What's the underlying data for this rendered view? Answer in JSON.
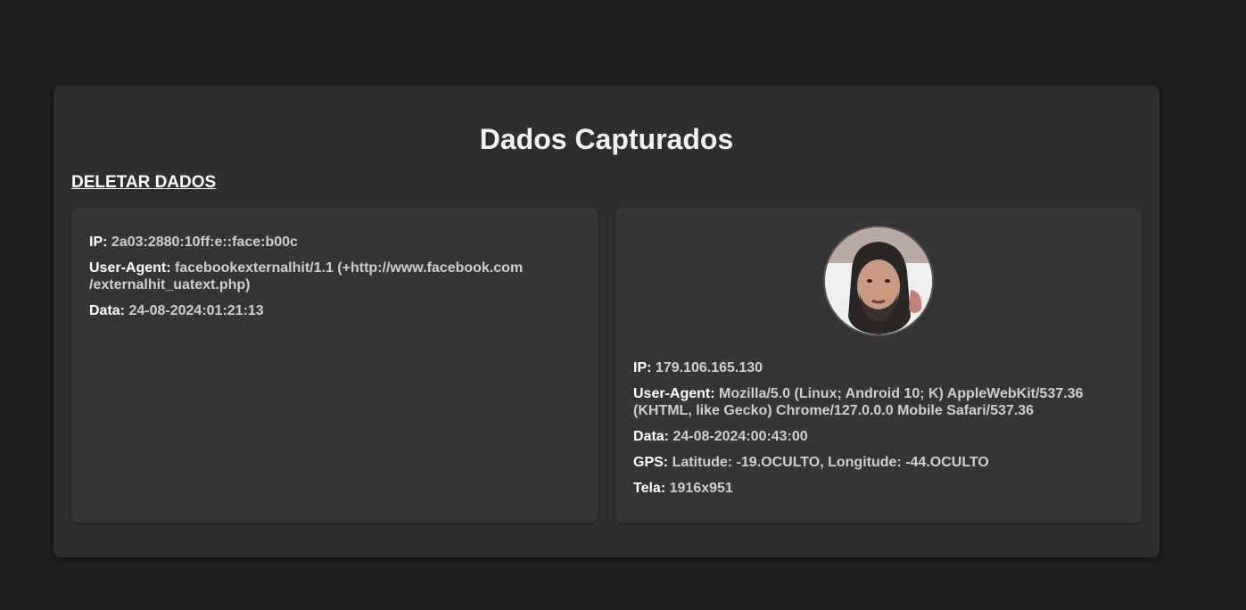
{
  "page": {
    "title": "Dados Capturados",
    "delete_label": "DELETAR DADOS"
  },
  "cards": [
    {
      "has_photo": false,
      "fields": [
        {
          "label": "IP:",
          "value": "2a03:2880:10ff:e::face:b00c"
        },
        {
          "label": "User-Agent:",
          "value": "facebookexternalhit/1.1 (+http://www.facebook.com/externalhit_uatext.php)"
        },
        {
          "label": "Data:",
          "value": "24-08-2024:01:21:13"
        }
      ]
    },
    {
      "has_photo": true,
      "fields": [
        {
          "label": "IP:",
          "value": "179.106.165.130"
        },
        {
          "label": "User-Agent:",
          "value": "Mozilla/5.0 (Linux; Android 10; K) AppleWebKit/537.36 (KHTML, like Gecko) Chrome/127.0.0.0 Mobile Safari/537.36"
        },
        {
          "label": "Data:",
          "value": "24-08-2024:00:43:00"
        },
        {
          "label": "GPS:",
          "value": "Latitude: -19.OCULTO, Longitude: -44.OCULTO"
        },
        {
          "label": "Tela:",
          "value": "1916x951"
        }
      ]
    }
  ]
}
